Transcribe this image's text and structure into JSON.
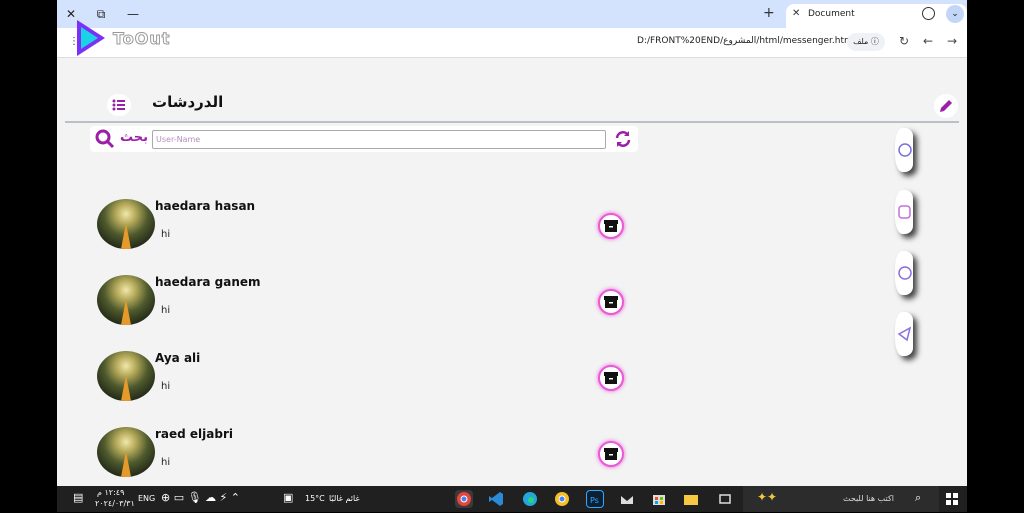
{
  "browser": {
    "tab_title": "Document",
    "tab_close": "✕",
    "new_tab": "+",
    "win_close": "✕",
    "win_restore": "⧉",
    "win_min": "—",
    "url": "D:/FRONT%20END/المشروع/html/messenger.html",
    "file_chip": "ملف ⓘ",
    "back": "←",
    "forward": "→",
    "reload": "↻",
    "menu": "⌄"
  },
  "watermark": {
    "text": "ToOut"
  },
  "app": {
    "title": "الدردشات",
    "search_label": "بحث",
    "search_placeholder": "User-Name",
    "chats": [
      {
        "name": "haedara hasan",
        "message": "hi"
      },
      {
        "name": "haedara ganem",
        "message": "hi"
      },
      {
        "name": "Aya ali",
        "message": "hi"
      },
      {
        "name": "raed eljabri",
        "message": "hi"
      }
    ],
    "social": [
      "facebook-icon",
      "instagram-icon",
      "whatsapp-icon",
      "telegram-icon"
    ],
    "accent": "#9b1fa7"
  },
  "taskbar": {
    "time": "١٢:٤٩ م",
    "date": "٢٠٢٤/٠٣/٣١",
    "lang": "ENG",
    "weather": "15°C",
    "weather_text": "غائم غالبًا",
    "search_placeholder": "اكتب هنا للبحث"
  }
}
